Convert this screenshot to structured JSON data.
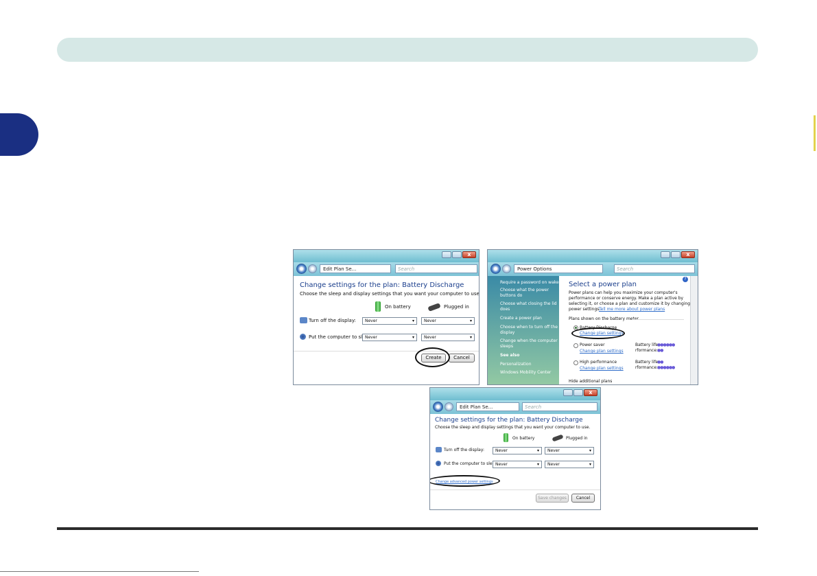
{
  "window1": {
    "breadcrumb": "Edit Plan Se...",
    "search_placeholder": "Search",
    "title": "Change settings for the plan: Battery Discharge",
    "subtitle": "Choose the sleep and display settings that you want your computer to use.",
    "on_battery": "On battery",
    "plugged_in": "Plugged in",
    "display_label": "Turn off the display:",
    "sleep_label": "Put the computer to sleep:",
    "display_battery": "Never",
    "display_plugged": "Never",
    "sleep_battery": "Never",
    "sleep_plugged": "Never",
    "create_button": "Create",
    "cancel_button": "Cancel"
  },
  "window2": {
    "breadcrumb": "Power Options",
    "search_placeholder": "Search",
    "sidebar": [
      "Require a password on wakeup",
      "Choose what the power",
      "buttons do",
      "Choose what closing the lid",
      "does",
      "Create a power plan",
      "Choose when to turn off the",
      "display",
      "Change when the computer",
      "sleeps"
    ],
    "see_also": "See also",
    "see_also_items": [
      "Personalization",
      "Windows Mobility Center"
    ],
    "title": "Select a power plan",
    "intro_lines": [
      "Power plans can help you maximize your computer's",
      "performance or conserve energy. Make a plan active by",
      "selecting it, or choose a plan and customize it by changing its"
    ],
    "intro_last": "power settings.",
    "intro_link": "Tell me more about power plans",
    "plans_header": "Plans shown on the battery meter",
    "plans": [
      {
        "name": "Battery Discharge",
        "link": "Change plan settings"
      },
      {
        "name": "Power saver",
        "link": "Change plan settings",
        "battery_life": "Battery life:",
        "performance": "rformance:"
      },
      {
        "name": "High performance",
        "link": "Change plan settings",
        "battery_life": "Battery life:",
        "performance": "rformance:"
      }
    ],
    "hide_plans": "Hide additional plans"
  },
  "window3": {
    "breadcrumb": "Edit Plan Se...",
    "search_placeholder": "Search",
    "title": "Change settings for the plan: Battery Discharge",
    "subtitle": "Choose the sleep and display settings that you want your computer to use.",
    "on_battery": "On battery",
    "plugged_in": "Plugged in",
    "display_label": "Turn off the display:",
    "sleep_label": "Put the computer to sleep:",
    "display_battery": "Never",
    "display_plugged": "Never",
    "sleep_battery": "Never",
    "sleep_plugged": "Never",
    "advanced_link": "Change advanced power settings",
    "save_button": "Save changes",
    "cancel_button": "Cancel"
  }
}
